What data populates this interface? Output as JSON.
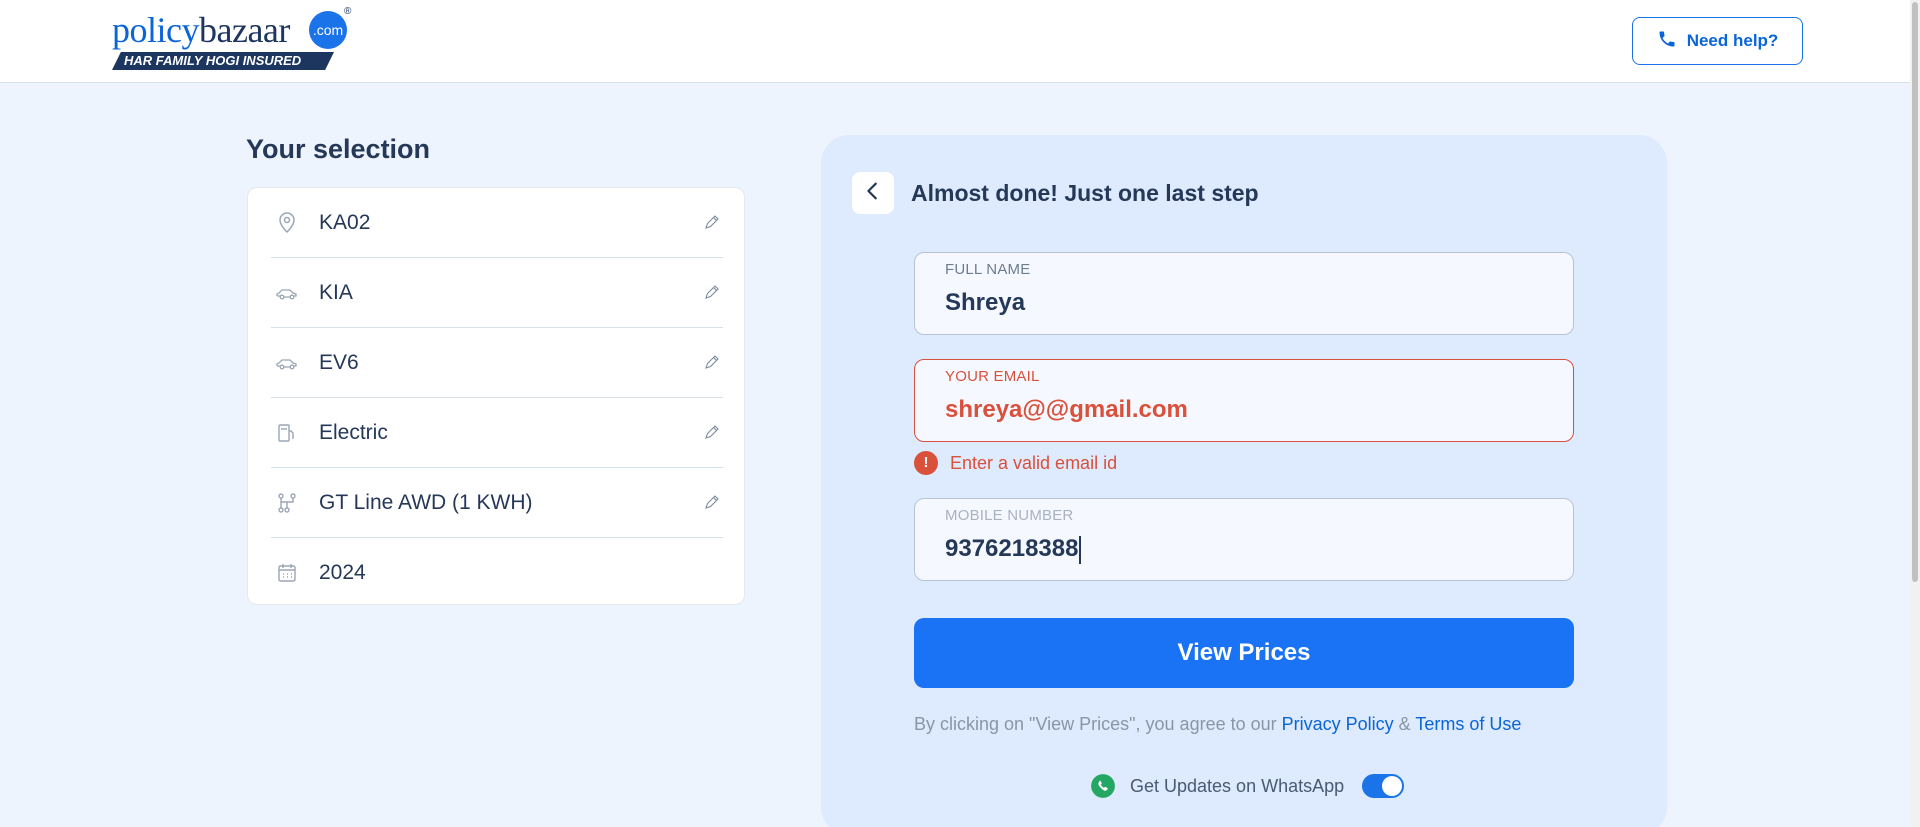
{
  "header": {
    "logo_part1": "policy",
    "logo_part2": "bazaar",
    "logo_com": ".com",
    "logo_reg": "®",
    "tagline": "HAR FAMILY HOGI INSURED",
    "help_label": "Need help?"
  },
  "selection": {
    "title": "Your selection",
    "items": [
      {
        "icon": "location-pin-icon",
        "label": "KA02",
        "editable": true
      },
      {
        "icon": "car-icon",
        "label": "KIA",
        "editable": true
      },
      {
        "icon": "car-icon",
        "label": "EV6",
        "editable": true
      },
      {
        "icon": "fuel-pump-icon",
        "label": "Electric",
        "editable": true
      },
      {
        "icon": "variant-icon",
        "label": "GT Line AWD (1 KWH)",
        "editable": true
      },
      {
        "icon": "calendar-icon",
        "label": "2024",
        "editable": false
      }
    ]
  },
  "form": {
    "title": "Almost done! Just one last step",
    "full_name": {
      "label": "FULL NAME",
      "value": "Shreya"
    },
    "email": {
      "label": "YOUR EMAIL",
      "value": "shreya@@gmail.com",
      "error": "Enter a valid email id"
    },
    "mobile": {
      "label": "MOBILE NUMBER",
      "value": "9376218388"
    },
    "submit_label": "View Prices",
    "terms_prefix": "By clicking on \"View Prices\", you agree to our ",
    "privacy_link": "Privacy Policy",
    "terms_amp": " & ",
    "terms_link": "Terms of Use",
    "whatsapp_label": "Get Updates on WhatsApp",
    "whatsapp_enabled": true
  },
  "colors": {
    "primary": "#1a73f5",
    "error": "#d9503b",
    "navy": "#253858",
    "panel_bg": "#deeafd",
    "page_bg": "#eef4fd"
  }
}
